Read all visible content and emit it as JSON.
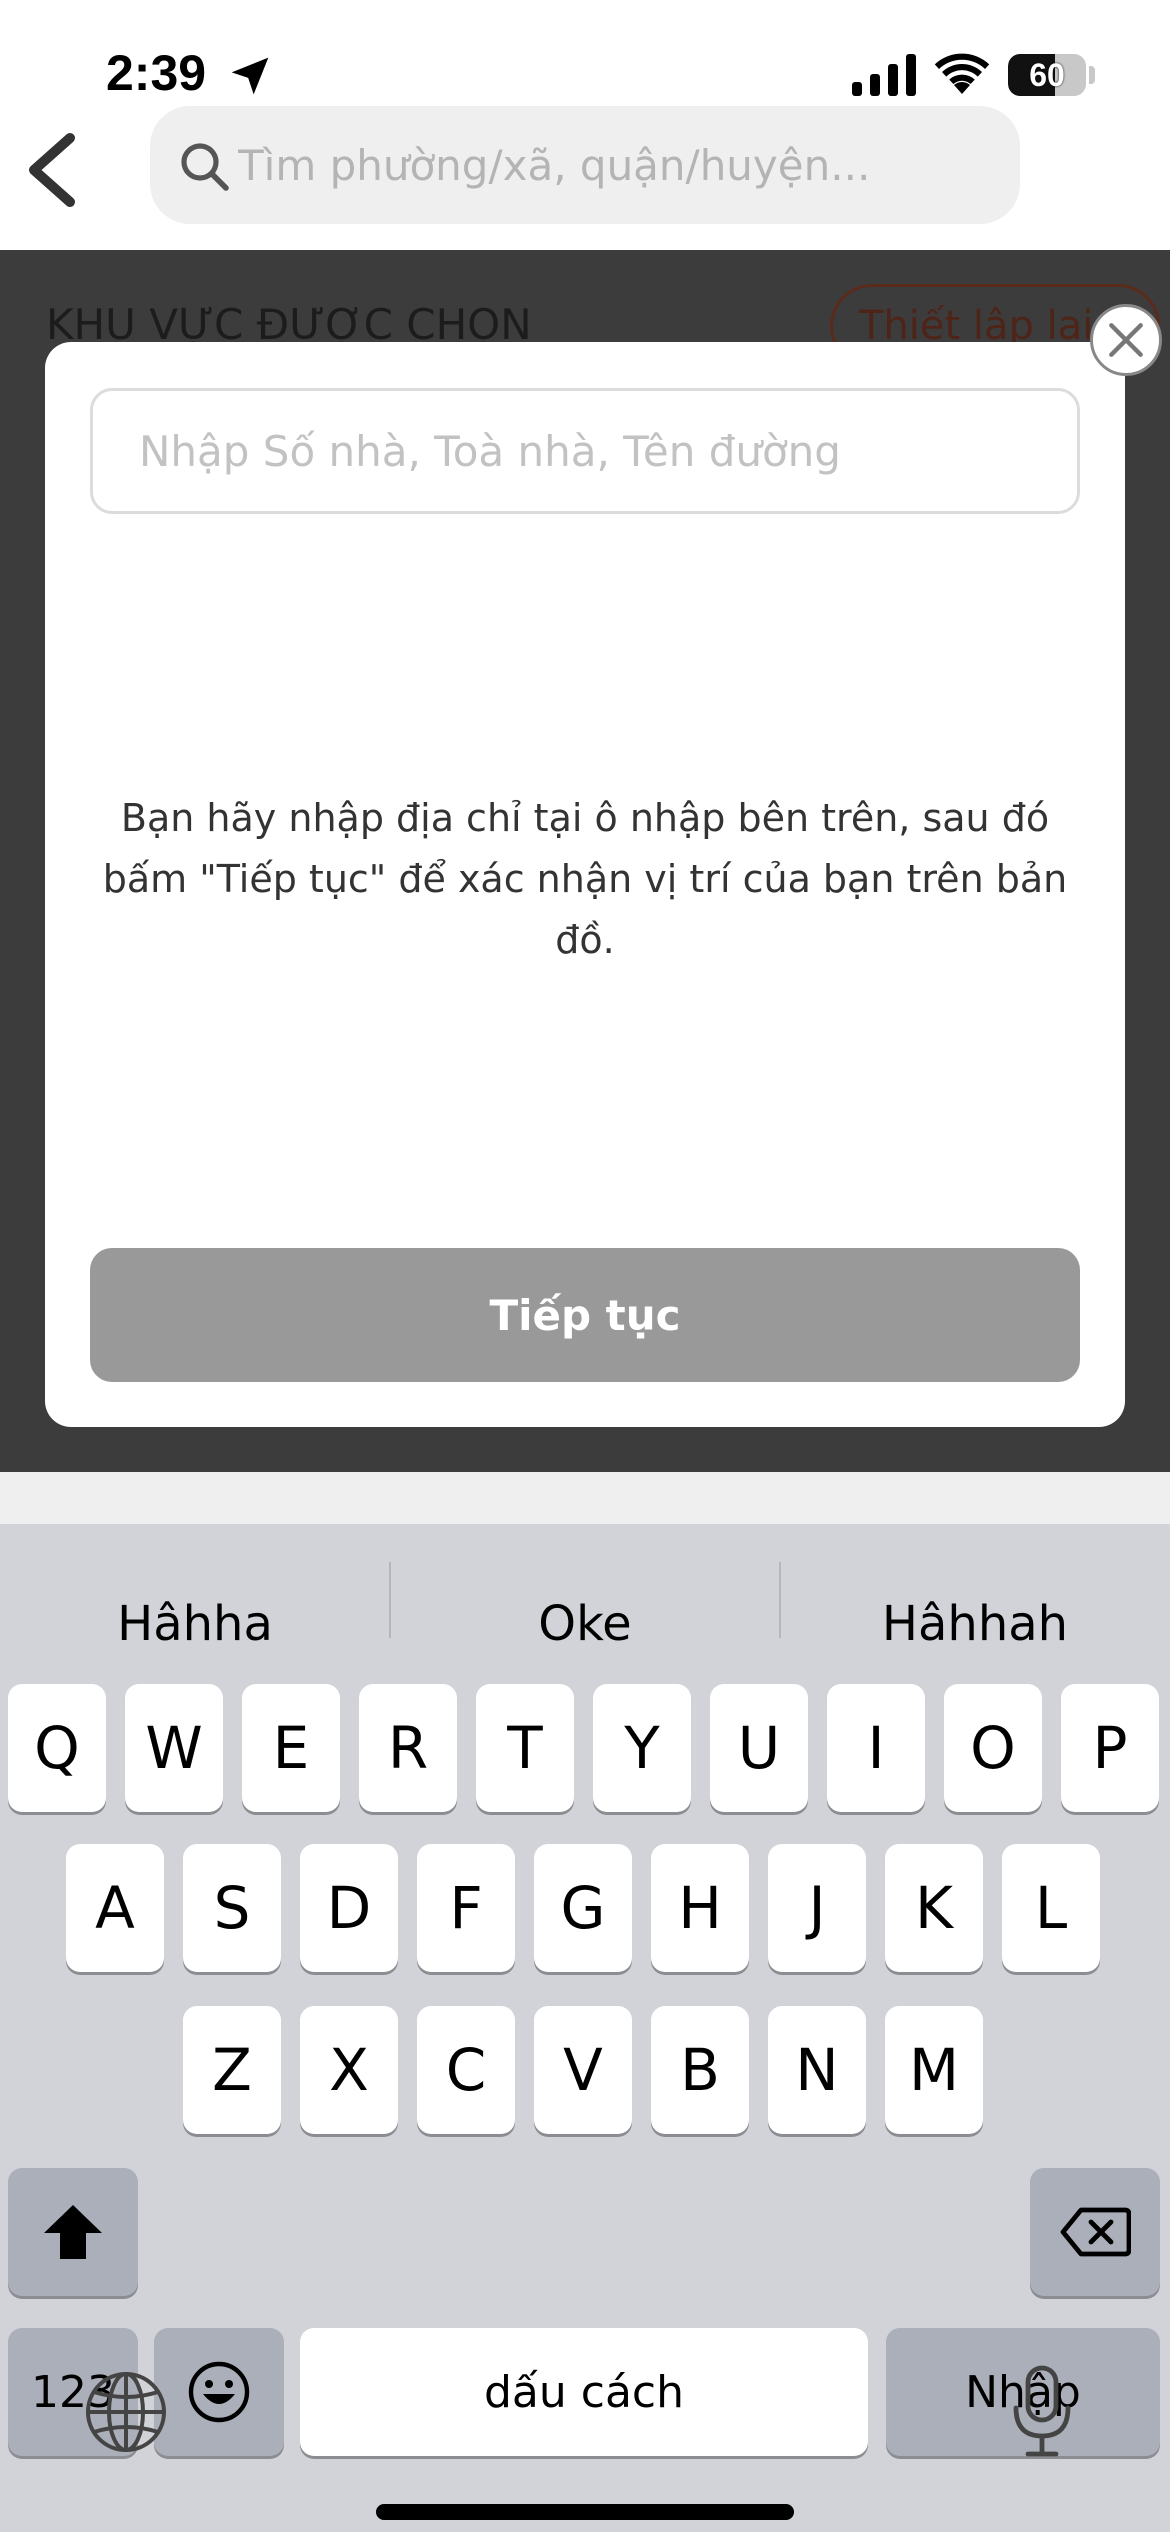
{
  "status_bar": {
    "time": "2:39",
    "battery_level": "60",
    "battery_fraction": 0.6
  },
  "header": {
    "search_placeholder": "Tìm phường/xã, quận/huyện..."
  },
  "background_page": {
    "section_title": "KHU VỰC ĐƯỢC CHỌN",
    "reset_button": "Thiết lập lại"
  },
  "modal": {
    "address_placeholder": "Nhập Số nhà, Toà nhà, Tên đường",
    "instruction": "Bạn hãy nhập địa chỉ tại ô nhập bên trên, sau đó bấm \"Tiếp tục\" để xác nhận vị trí của bạn trên bản đồ.",
    "continue_label": "Tiếp tục"
  },
  "keyboard": {
    "suggestions": [
      "Hâhha",
      "Oke",
      "Hâhhah"
    ],
    "row1": [
      "Q",
      "W",
      "E",
      "R",
      "T",
      "Y",
      "U",
      "I",
      "O",
      "P"
    ],
    "row2": [
      "A",
      "S",
      "D",
      "F",
      "G",
      "H",
      "J",
      "K",
      "L"
    ],
    "row3": [
      "Z",
      "X",
      "C",
      "V",
      "B",
      "N",
      "M"
    ],
    "numbers_key": "123",
    "space_key": "dấu cách",
    "return_key": "Nhập"
  },
  "icons": {
    "back": "chevron-left-icon",
    "search": "search-icon",
    "close": "close-icon",
    "shift": "shift-icon",
    "backspace": "backspace-icon",
    "emoji": "emoji-icon",
    "globe": "globe-icon",
    "mic": "microphone-icon"
  }
}
